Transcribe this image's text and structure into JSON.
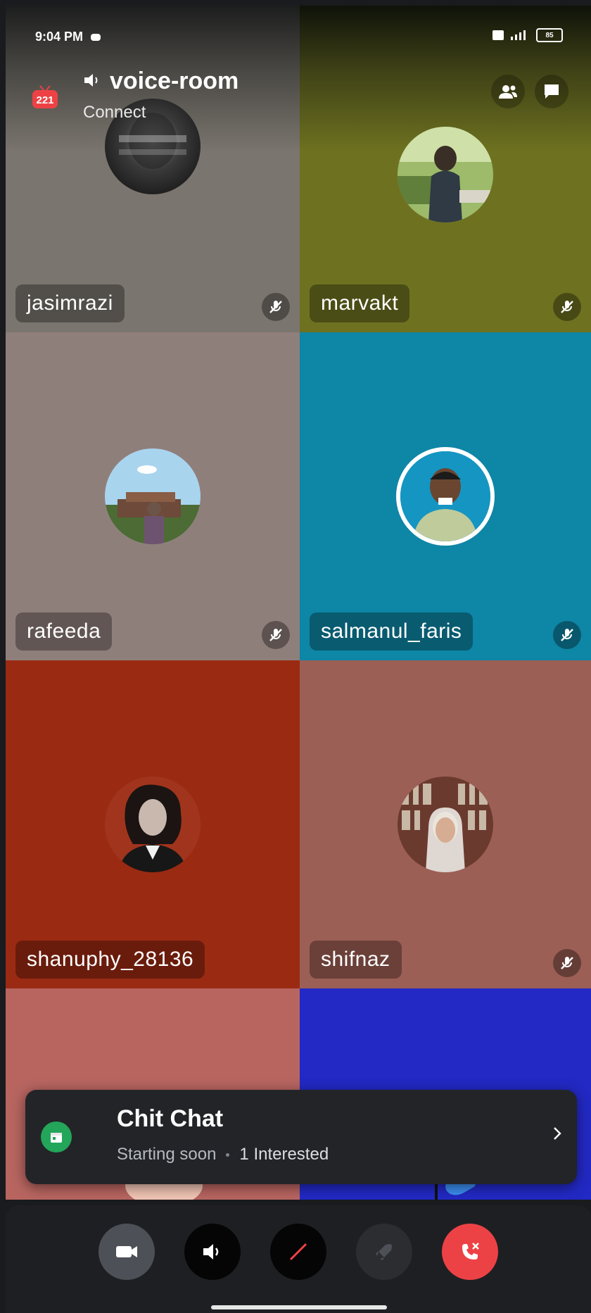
{
  "status_bar": {
    "time": "9:04 PM",
    "battery": "85"
  },
  "header": {
    "badge": "221",
    "room_name": "voice-room",
    "subtitle": "Connect"
  },
  "participants": [
    {
      "name": "jasimrazi",
      "muted": true,
      "color": "#7a756e"
    },
    {
      "name": "marvakt",
      "muted": true,
      "color": "#6e7220"
    },
    {
      "name": "rafeeda",
      "muted": true,
      "color": "#8f7f7b"
    },
    {
      "name": "salmanul_faris",
      "muted": true,
      "color": "#0e86a6"
    },
    {
      "name": "shanuphy_28136",
      "muted": false,
      "color": "#9b2a13"
    },
    {
      "name": "shifnaz",
      "muted": true,
      "color": "#9c5f55"
    }
  ],
  "partial_tiles": [
    {
      "color": "#b86560"
    },
    {
      "color": "#2229c4"
    }
  ],
  "event_banner": {
    "title": "Chit Chat",
    "status": "Starting soon",
    "interested": "1 Interested"
  },
  "controls": [
    {
      "icon": "camera-icon",
      "bg": "#4e5058"
    },
    {
      "icon": "speaker-icon",
      "bg": "#050505"
    },
    {
      "icon": "mic-muted-icon",
      "bg": "#050505"
    },
    {
      "icon": "activity-rocket-icon",
      "bg": "#2b2d31"
    },
    {
      "icon": "leave-call-icon",
      "bg": "#ed4245"
    }
  ]
}
